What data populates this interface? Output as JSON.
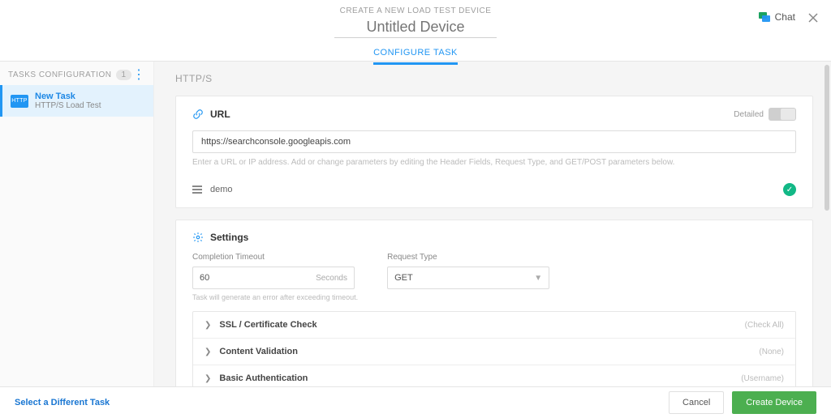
{
  "header": {
    "banner": "CREATE A NEW LOAD TEST DEVICE",
    "device_name_placeholder": "Untitled Device",
    "tab_label": "CONFIGURE TASK",
    "chat_label": "Chat"
  },
  "sidebar": {
    "title": "TASKS CONFIGURATION",
    "count": "1",
    "task": {
      "icon_label": "HTTP",
      "name": "New Task",
      "type": "HTTP/S Load Test"
    }
  },
  "section": {
    "title": "HTTP/S"
  },
  "url_card": {
    "title": "URL",
    "detailed_label": "Detailed",
    "toggle_state": "OFF",
    "url_value": "https://searchconsole.googleapis.com",
    "hint": "Enter a URL or IP address. Add or change parameters by editing the Header Fields, Request Type, and GET/POST parameters below.",
    "demo_label": "demo"
  },
  "settings_card": {
    "title": "Settings",
    "timeout": {
      "label": "Completion Timeout",
      "value": "60",
      "suffix": "Seconds",
      "hint": "Task will generate an error after exceeding timeout."
    },
    "request_type": {
      "label": "Request Type",
      "value": "GET"
    },
    "accordion": [
      {
        "title": "SSL / Certificate Check",
        "status": "(Check All)"
      },
      {
        "title": "Content Validation",
        "status": "(None)"
      },
      {
        "title": "Basic Authentication",
        "status": "(Username)"
      }
    ]
  },
  "footer": {
    "select_different": "Select a Different Task",
    "cancel": "Cancel",
    "create": "Create Device"
  }
}
